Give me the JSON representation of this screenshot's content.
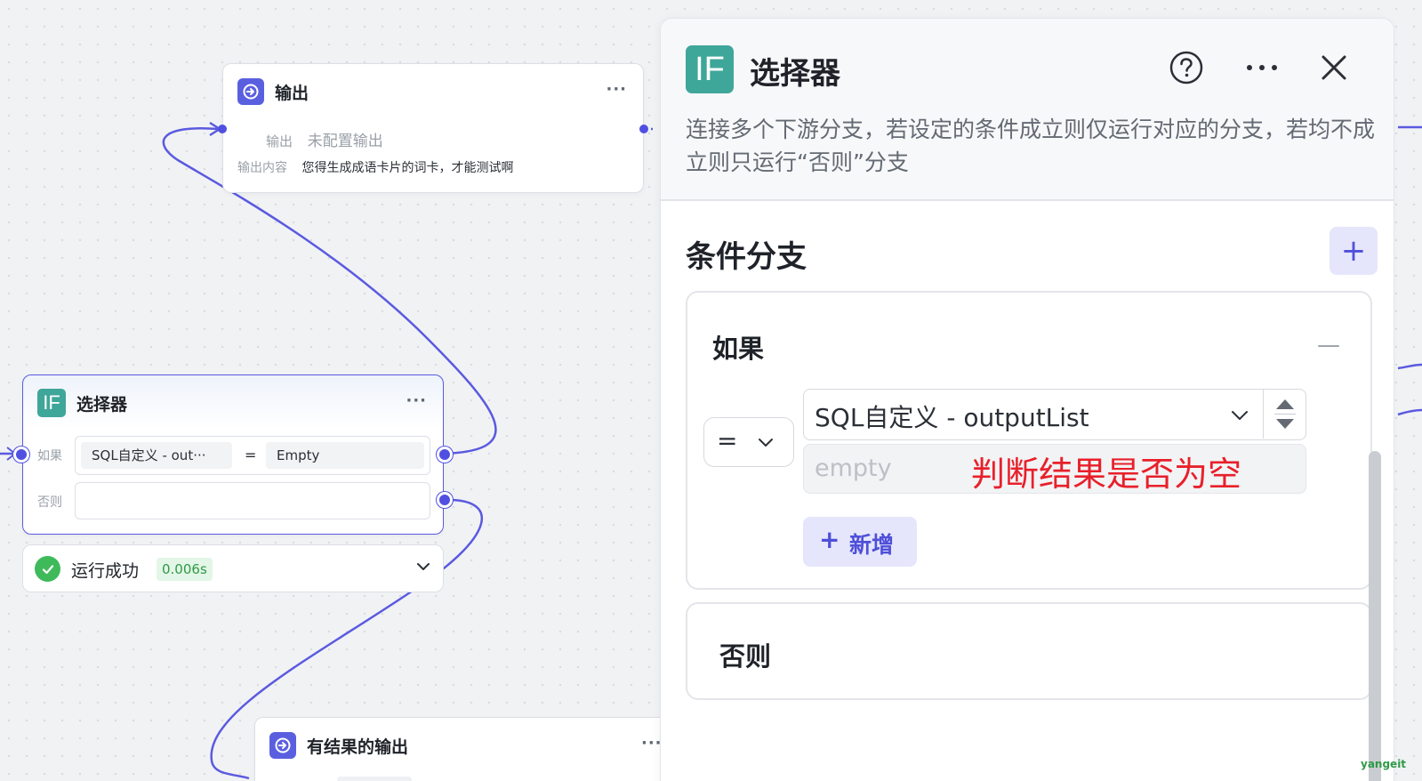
{
  "output_node": {
    "title": "输出",
    "more": "···",
    "row1_label": "输出",
    "row1_value": "未配置输出",
    "row2_label": "输出内容",
    "row2_value": "您得生成成语卡片的词卡，才能测试啊"
  },
  "selector_node": {
    "icon_text": "IF",
    "title": "选择器",
    "more": "···",
    "if_label": "如果",
    "condition_left": "SQL自定义 - out···",
    "operator": "=",
    "condition_right": "Empty",
    "else_label": "否则",
    "else_value": ""
  },
  "run_status": {
    "text": "运行成功",
    "duration": "0.006s"
  },
  "result_node": {
    "title": "有结果的输出",
    "more": "···"
  },
  "panel": {
    "icon_text": "IF",
    "title": "选择器",
    "description": "连接多个下游分支，若设定的条件成立则仅运行对应的分支，若均不成立则只运行“否则”分支",
    "section_title": "条件分支",
    "add_symbol": "+",
    "if_title": "如果",
    "collapse_symbol": "—",
    "operator": "=",
    "variable": "SQL自定义 - outputList",
    "value_placeholder": "empty",
    "annotation": "判断结果是否为空",
    "add_condition": "新增",
    "add_condition_symbol": "+",
    "else_title": "否则"
  },
  "watermark": "yangeit",
  "colors": {
    "accent": "#5050e0",
    "if_icon": "#3fa69a",
    "success": "#3fba5a",
    "annotation": "#e8202a"
  }
}
